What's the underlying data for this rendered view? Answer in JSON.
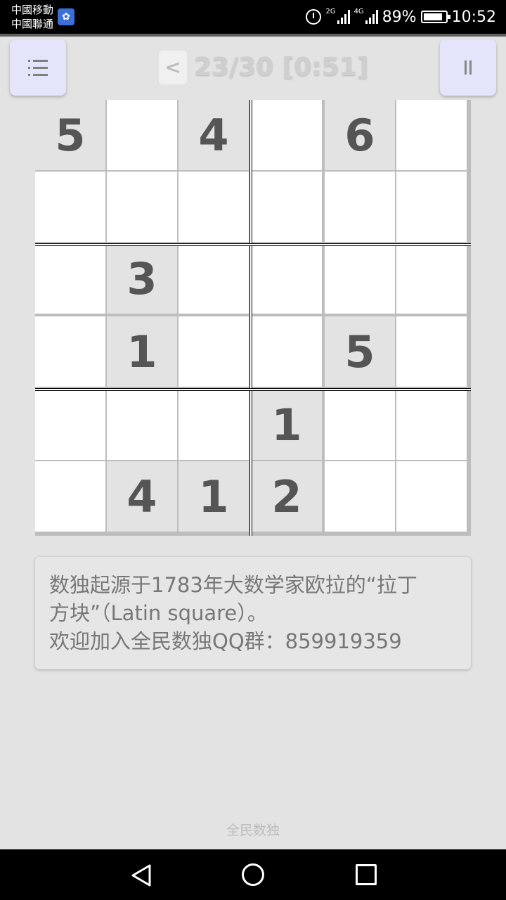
{
  "status_bar": {
    "carrier_1": "中國移動",
    "carrier_2": "中國聯通",
    "net_1": "2G",
    "net_2": "4G",
    "battery": "89%",
    "battery_level": 0.89,
    "time": "10:52"
  },
  "header": {
    "back_label": "<",
    "progress": "23/30 [0:51]"
  },
  "board": [
    [
      "5",
      "",
      "4",
      "",
      "6",
      ""
    ],
    [
      "",
      "",
      "",
      "",
      "",
      ""
    ],
    [
      "",
      "3",
      "",
      "",
      "",
      ""
    ],
    [
      "",
      "1",
      "",
      "",
      "5",
      ""
    ],
    [
      "",
      "",
      "",
      "1",
      "",
      ""
    ],
    [
      "",
      "4",
      "1",
      "2",
      "",
      ""
    ]
  ],
  "info": {
    "line_1": "数独起源于1783年大数学家欧拉的“拉丁",
    "line_2": "方块”（Latin square）。",
    "line_3": "欢迎加入全民数独QQ群：859919359"
  },
  "footer": {
    "app_name": "全民数独"
  },
  "colors": {
    "background": "#e3e3e3",
    "given_cell": "#e3e3e3",
    "button": "#e4e4fb",
    "digit": "#555555"
  }
}
